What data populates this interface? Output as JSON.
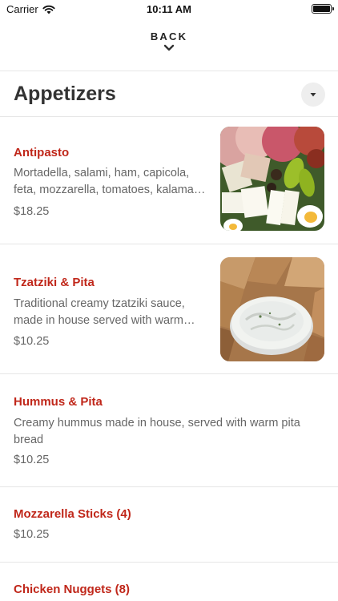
{
  "status_bar": {
    "carrier": "Carrier",
    "time": "10:11 AM"
  },
  "nav": {
    "back_label": "BACK"
  },
  "section": {
    "title": "Appetizers"
  },
  "items": [
    {
      "name": "Antipasto",
      "description_line1": "Mortadella, salami, ham, capicola,",
      "description_line2": "feta, mozzarella, tomatoes, kalama…",
      "price": "$18.25",
      "image": "antipasto-platter"
    },
    {
      "name": "Tzatziki & Pita",
      "description_line1": "Traditional creamy tzatziki sauce,",
      "description_line2": "made in house served with warm…",
      "price": "$10.25",
      "image": "tzatziki-bowl-with-pita"
    },
    {
      "name": "Hummus & Pita",
      "description_line1": "Creamy hummus made in house, served with warm pita",
      "description_line2": "bread",
      "price": "$10.25"
    },
    {
      "name": "Mozzarella Sticks (4)",
      "price": "$10.25"
    },
    {
      "name": "Chicken Nuggets (8)"
    }
  ],
  "colors": {
    "item_name": "#c0271a",
    "text_secondary": "#666666",
    "divider": "#e6e6e6"
  }
}
